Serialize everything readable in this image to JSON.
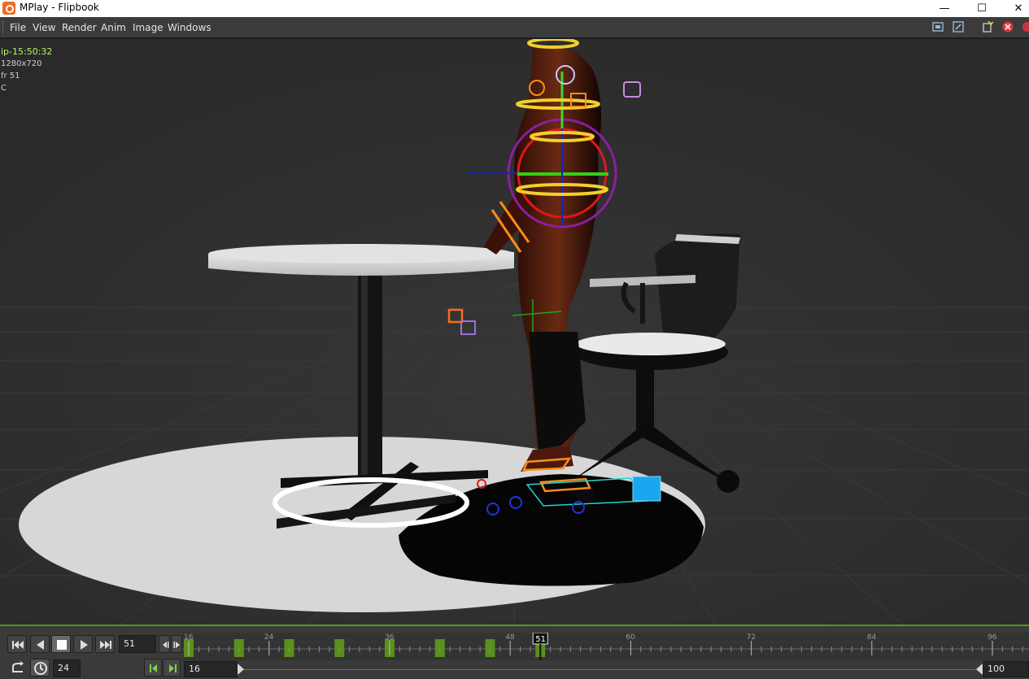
{
  "window": {
    "title": "MPlay - Flipbook",
    "minimize": "—",
    "maximize": "☐",
    "close": "✕"
  },
  "menu": {
    "items": [
      "File",
      "View",
      "Render",
      "Anim",
      "Image",
      "Windows"
    ]
  },
  "overlay": {
    "timestamp": "ip-15:50:32",
    "resolution": "1280x720",
    "frame": "fr 51",
    "channel": "C"
  },
  "playback": {
    "current_frame": "51",
    "fps": "24",
    "range_start": "16",
    "range_end": "100"
  },
  "timeline": {
    "tick_labels": [
      "16",
      "24",
      "36",
      "48",
      "60",
      "72",
      "84",
      "96"
    ],
    "cursor_label": "51",
    "keyframes": [
      16,
      21,
      26,
      31,
      36,
      41,
      46,
      51
    ],
    "key_color": "#5a8f1c"
  },
  "colors": {
    "accent_green": "#4b9a1c",
    "viewport_bg": "#2c2c2c"
  }
}
